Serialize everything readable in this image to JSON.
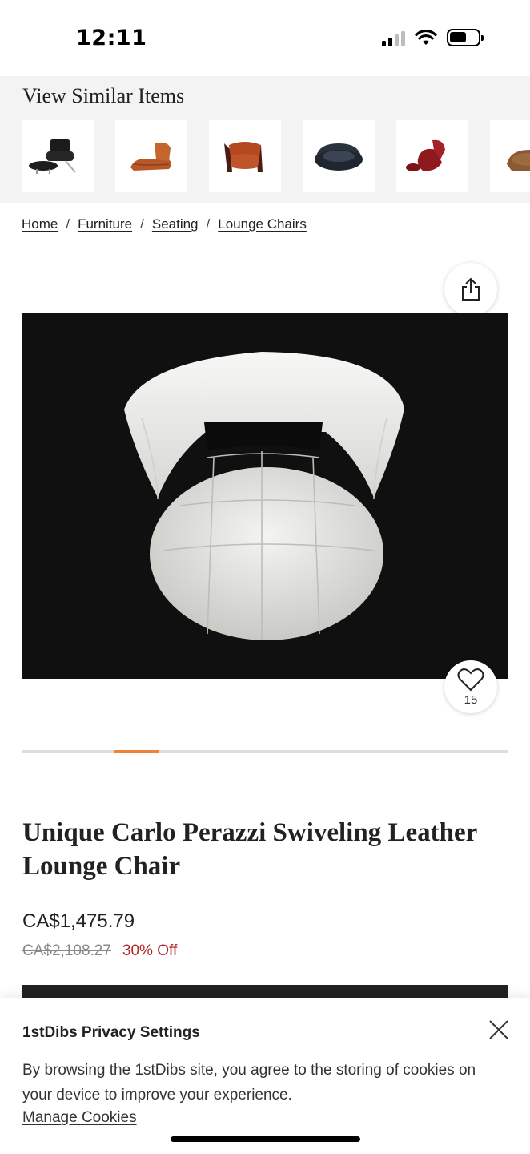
{
  "status_bar": {
    "time": "12:11"
  },
  "similar_items": {
    "title": "View Similar Items",
    "thumbnails": [
      "black-leather-lounge-chair-with-ottoman",
      "cognac-leather-sling-lounge-chair",
      "rust-leather-wood-frame-armchair",
      "black-round-tub-chair",
      "red-leather-chair-with-ottoman",
      "brown-leather-chair"
    ]
  },
  "breadcrumb": {
    "items": [
      "Home",
      "Furniture",
      "Seating",
      "Lounge Chairs"
    ],
    "separator": "/"
  },
  "favorite": {
    "count": "15"
  },
  "carousel": {
    "position": 0.19
  },
  "product": {
    "title": "Unique Carlo Perazzi Swiveling Leather Lounge Chair",
    "price": "CA$1,475.79",
    "original_price": "CA$2,108.27",
    "discount": "30% Off"
  },
  "privacy": {
    "title": "1stDibs Privacy Settings",
    "text": "By browsing the 1stDibs site, you agree to the storing of cookies on your device to improve your experience.",
    "link": "Manage Cookies"
  },
  "colors": {
    "accent": "#f0813a",
    "discount": "#b3262b",
    "strip_background": "#f3f3f3"
  }
}
